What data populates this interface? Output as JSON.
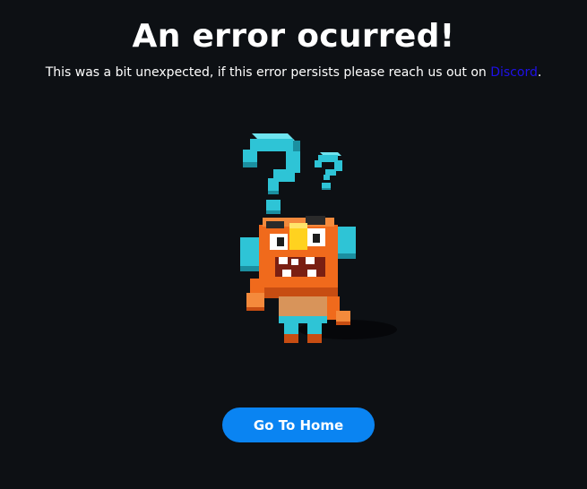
{
  "header": {
    "title": "An error ocurred!",
    "message": "This was a bit unexpected, if this error persists please reach us out on ",
    "link_label": "Discord",
    "message_end": "."
  },
  "illustration": {
    "icon": "confused-voxel-character-icon",
    "colors": {
      "question_marks": "#2ec4d6",
      "body": "#f06a1c",
      "shadow": "#07080a"
    }
  },
  "actions": {
    "home_label": "Go To Home"
  },
  "colors": {
    "background": "#0d1014",
    "link": "#1f10e8",
    "button": "#0a84f2"
  }
}
